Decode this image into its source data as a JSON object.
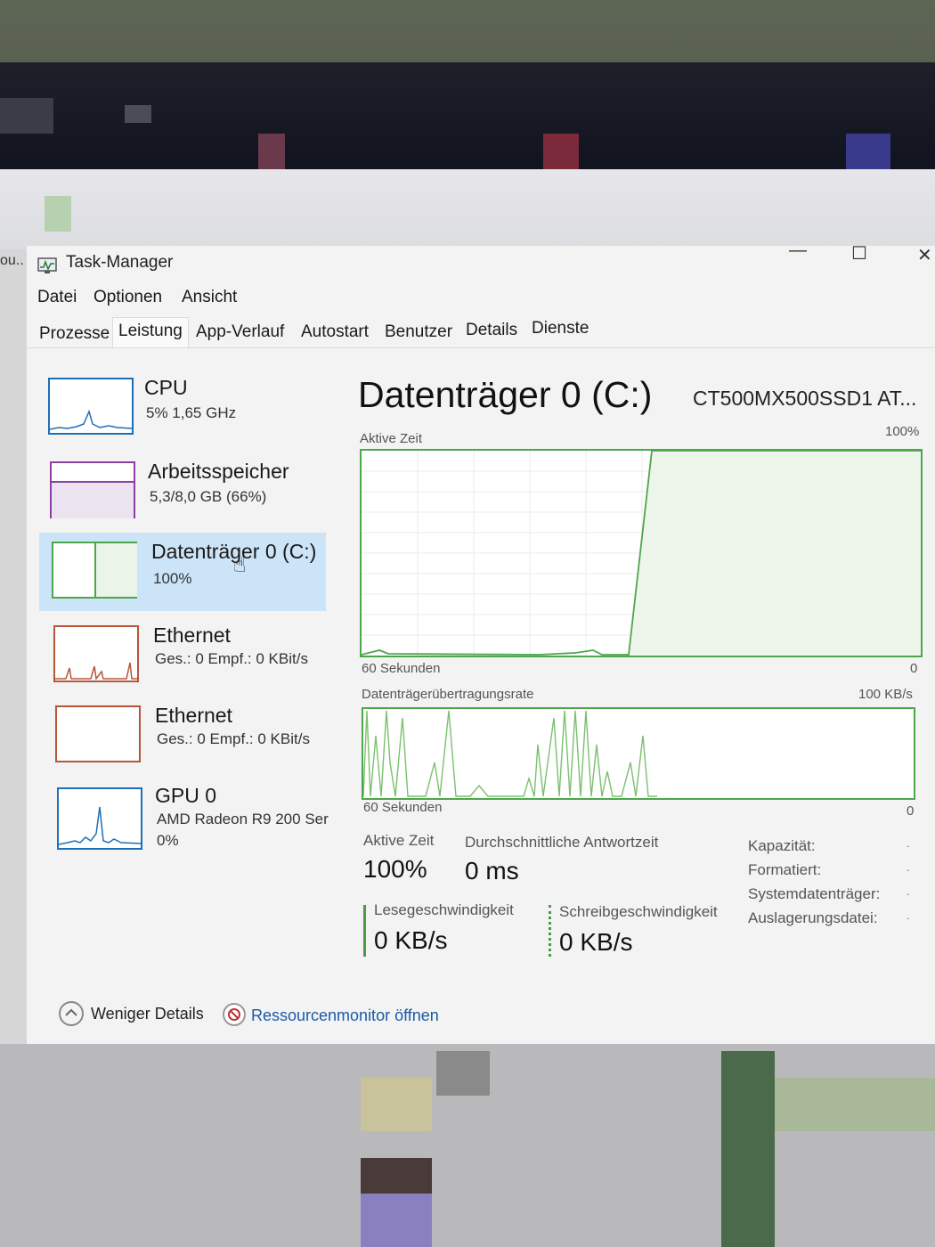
{
  "outside": {
    "left_label": "ou.."
  },
  "window": {
    "title": "Task-Manager",
    "controls": {
      "minimize": "—",
      "maximize": "☐",
      "close": "✕"
    }
  },
  "menu": [
    "Datei",
    "Optionen",
    "Ansicht"
  ],
  "tabs": [
    "Prozesse",
    "Leistung",
    "App-Verlauf",
    "Autostart",
    "Benutzer",
    "Details",
    "Dienste"
  ],
  "active_tab": "Leistung",
  "resources": [
    {
      "title": "CPU",
      "sub1": "5% 1,65 GHz",
      "color": "#1f6fb5"
    },
    {
      "title": "Arbeitsspeicher",
      "sub1": "5,3/8,0 GB (66%)",
      "color": "#8b3fa3"
    },
    {
      "title": "Datenträger 0 (C:)",
      "sub1": "100%",
      "color": "#4da64a"
    },
    {
      "title": "Ethernet",
      "sub1": "Ges.: 0 Empf.: 0 KBit/s",
      "color": "#b5563a"
    },
    {
      "title": "Ethernet",
      "sub1": "Ges.: 0 Empf.: 0 KBit/s",
      "color": "#b5563a"
    },
    {
      "title": "GPU 0",
      "sub1": "AMD Radeon R9 200 Ser",
      "sub2": "0%",
      "color": "#1f6fb5"
    }
  ],
  "detail": {
    "title": "Datenträger 0 (C:)",
    "model": "CT500MX500SSD1 AT...",
    "graph1": {
      "label": "Aktive Zeit",
      "max": "100%",
      "time": "60 Sekunden",
      "min": "0"
    },
    "graph2": {
      "label": "Datenträgerübertragungsrate",
      "max": "100 KB/s",
      "time": "60 Sekunden",
      "min": "0"
    },
    "stats": {
      "active_time_label": "Aktive Zeit",
      "active_time_value": "100%",
      "response_label": "Durchschnittliche Antwortzeit",
      "response_value": "0 ms",
      "read_label": "Lesegeschwindigkeit",
      "read_value": "0 KB/s",
      "write_label": "Schreibgeschwindigkeit",
      "write_value": "0 KB/s"
    },
    "properties": [
      {
        "label": "Kapazität:",
        "value": "."
      },
      {
        "label": "Formatiert:",
        "value": "."
      },
      {
        "label": "Systemdatenträger:",
        "value": "."
      },
      {
        "label": "Auslagerungsdatei:",
        "value": "."
      }
    ]
  },
  "footer": {
    "less_details": "Weniger Details",
    "resource_monitor": "Ressourcenmonitor öffnen"
  }
}
